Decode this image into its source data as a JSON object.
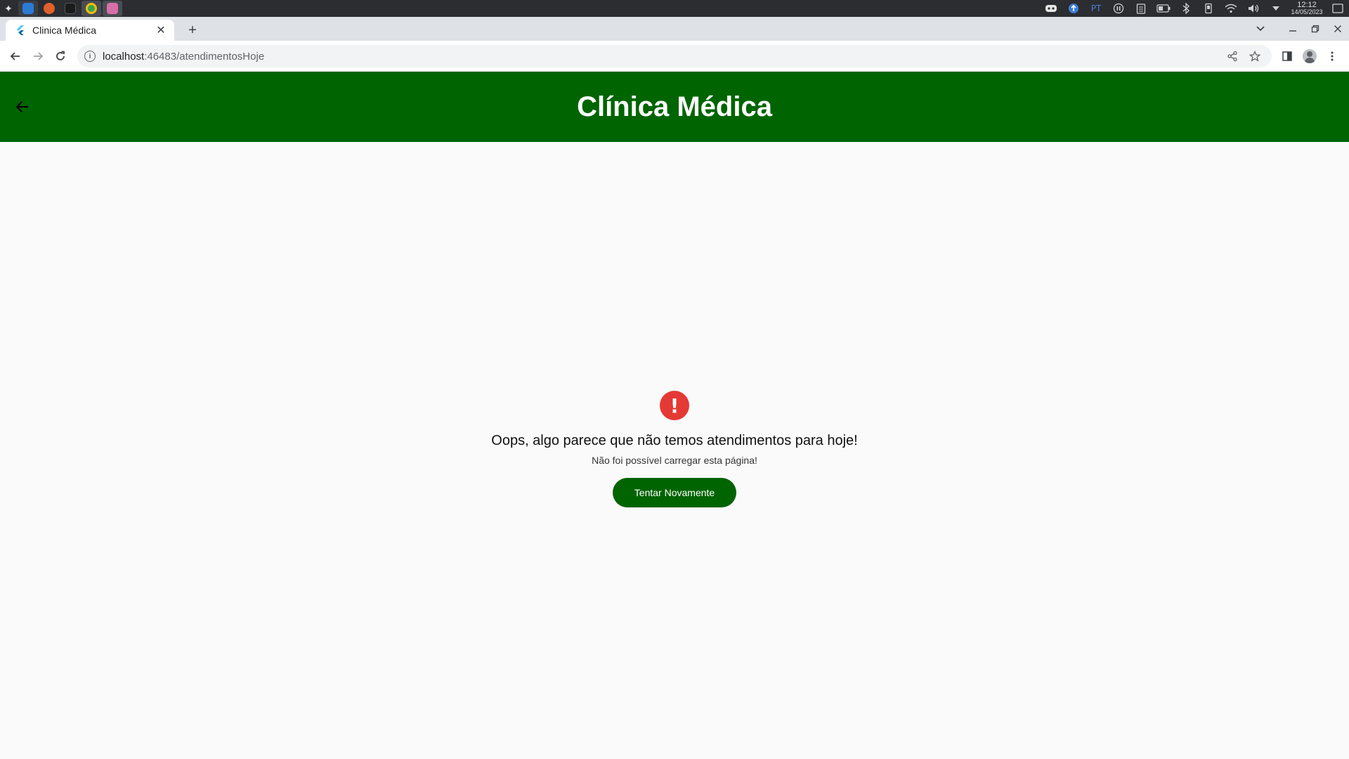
{
  "os": {
    "lang": "PT",
    "time": "12:12",
    "date": "14/05/2023"
  },
  "browser": {
    "tab_title": "Clinica Médica",
    "new_tab_label": "+",
    "url_host": "localhost",
    "url_path": ":46483/atendimentosHoje"
  },
  "app": {
    "title": "Clínica Médica"
  },
  "error": {
    "title": "Oops, algo parece que não temos atendimentos para hoje!",
    "subtitle": "Não foi possível carregar esta página!",
    "button_label": "Tentar Novamente",
    "icon_symbol": "!"
  },
  "colors": {
    "brand_green": "#006400",
    "error_red": "#e53935"
  }
}
